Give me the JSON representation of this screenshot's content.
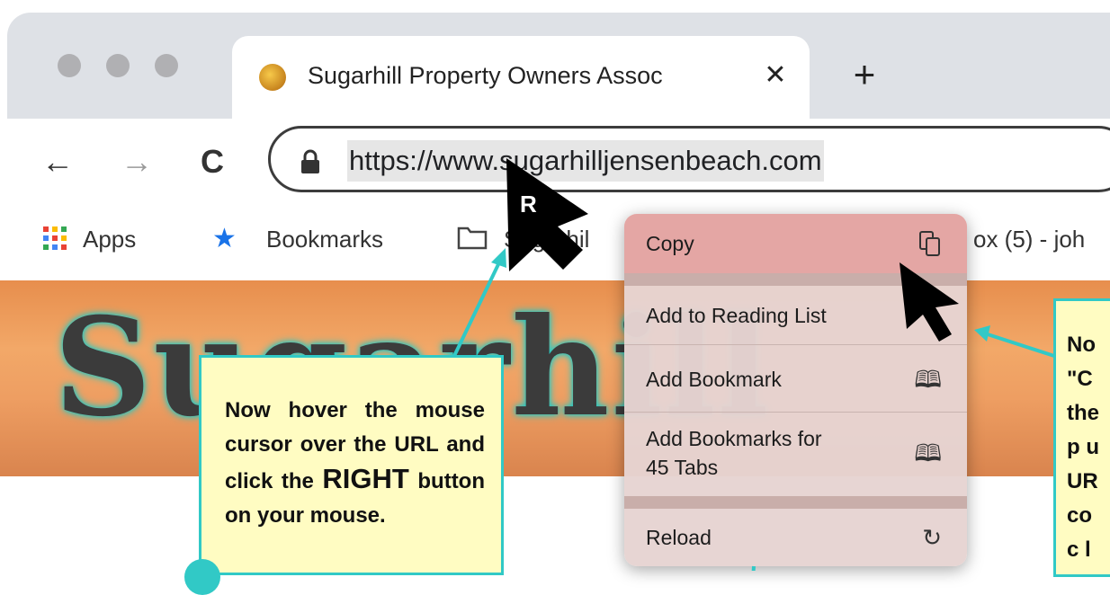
{
  "browser": {
    "tab": {
      "title": "Sugarhill Property Owners Assoc",
      "close_label": "✕"
    },
    "new_tab_label": "+",
    "nav": {
      "back": "←",
      "forward": "→",
      "reload": "C"
    },
    "omnibox": {
      "url": "https://www.sugarhilljensenbeach.com"
    },
    "bookmarks_bar": [
      {
        "label": "Apps"
      },
      {
        "label": "Bookmarks"
      },
      {
        "label": "Sugarhil"
      },
      {
        "label": "ox (5) - joh"
      }
    ]
  },
  "page_banner": {
    "text": "Sugarhill"
  },
  "cursor_label": "R",
  "context_menu": {
    "items": [
      {
        "label": "Copy",
        "icon": "copy-icon"
      },
      {
        "label": "Add to Reading List",
        "icon": ""
      },
      {
        "label": "Add Bookmark",
        "icon": "book-icon"
      },
      {
        "label": "Add Bookmarks for",
        "label_line2": "45 Tabs",
        "icon": "book-icon"
      },
      {
        "label": "Reload",
        "icon": "reload-icon"
      }
    ]
  },
  "callouts": {
    "left": {
      "text_before": "Now hover the mouse cursor over the URL and click the ",
      "highlight": "RIGHT",
      "text_after": " button on your mouse."
    },
    "right": {
      "lines": [
        "No",
        "\"C",
        "the",
        "p u",
        "UR",
        "co",
        "c l"
      ]
    }
  },
  "colors": {
    "callout_fill": "#fffcc2",
    "callout_border": "#31c9c6",
    "arrow": "#31c9c6",
    "menu_highlight": "#e4a6a4"
  }
}
